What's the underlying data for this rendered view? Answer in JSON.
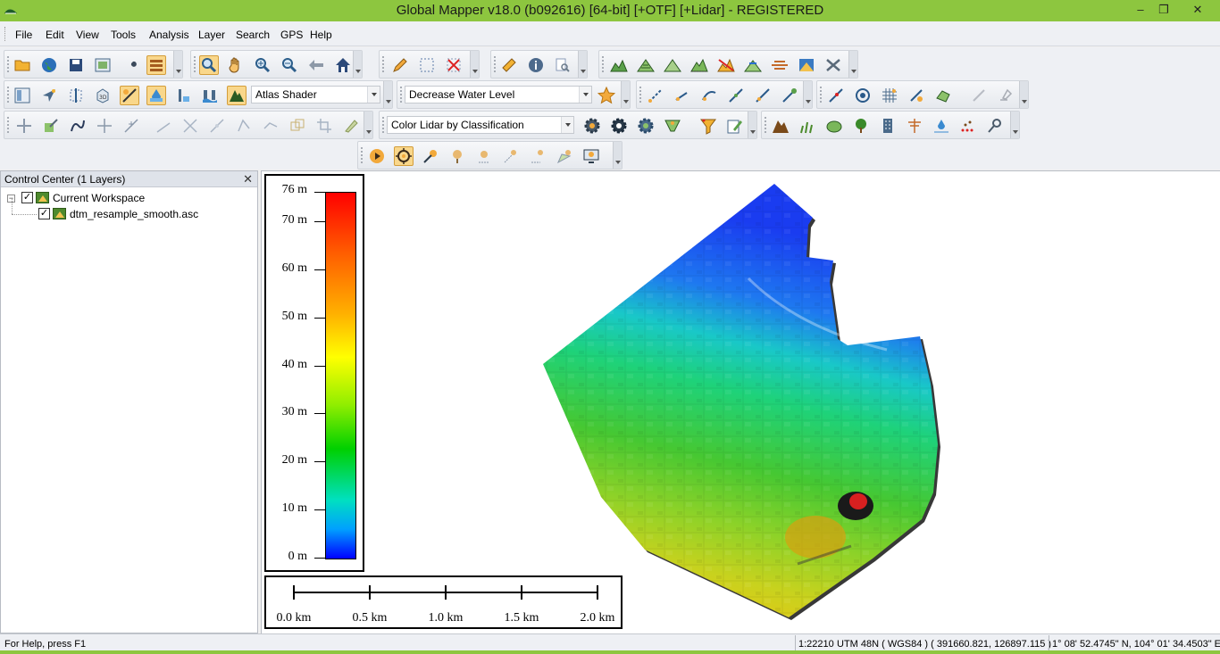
{
  "window": {
    "title": "Global Mapper v18.0 (b092616) [64-bit] [+OTF] [+Lidar] - REGISTERED",
    "minimize": "–",
    "maximize": "❐",
    "close": "✕"
  },
  "menu": [
    "File",
    "Edit",
    "View",
    "Tools",
    "Analysis",
    "Layer",
    "Search",
    "GPS",
    "Help"
  ],
  "toolbar": {
    "shader_select": "Atlas Shader",
    "water_level_select": "Decrease Water Level",
    "lidar_color_select": "Color Lidar by Classification"
  },
  "control_center": {
    "title": "Control Center (1 Layers)",
    "close": "✕",
    "workspace": "Current Workspace",
    "layers": [
      "dtm_resample_smooth.asc"
    ]
  },
  "legend": {
    "labels": [
      "76 m",
      "70 m",
      "60 m",
      "50 m",
      "40 m",
      "30 m",
      "20 m",
      "10 m",
      "0 m"
    ],
    "colors": [
      "#ff0000",
      "#ff6000",
      "#ffb000",
      "#ffff00",
      "#90ee00",
      "#00d000",
      "#00e0c0",
      "#00a0ff",
      "#0000ff"
    ]
  },
  "scale_bar": {
    "labels": [
      "0.0 km",
      "0.5 km",
      "1.0 km",
      "1.5 km",
      "2.0 km"
    ]
  },
  "status": {
    "help": "For Help, press F1",
    "scale": "1:22210",
    "projection": "UTM 48N ( WGS84 ) ( 391660.821, 126897.115 )",
    "geo": "1° 08' 52.4745\" N, 104° 01' 34.4503\" E"
  }
}
